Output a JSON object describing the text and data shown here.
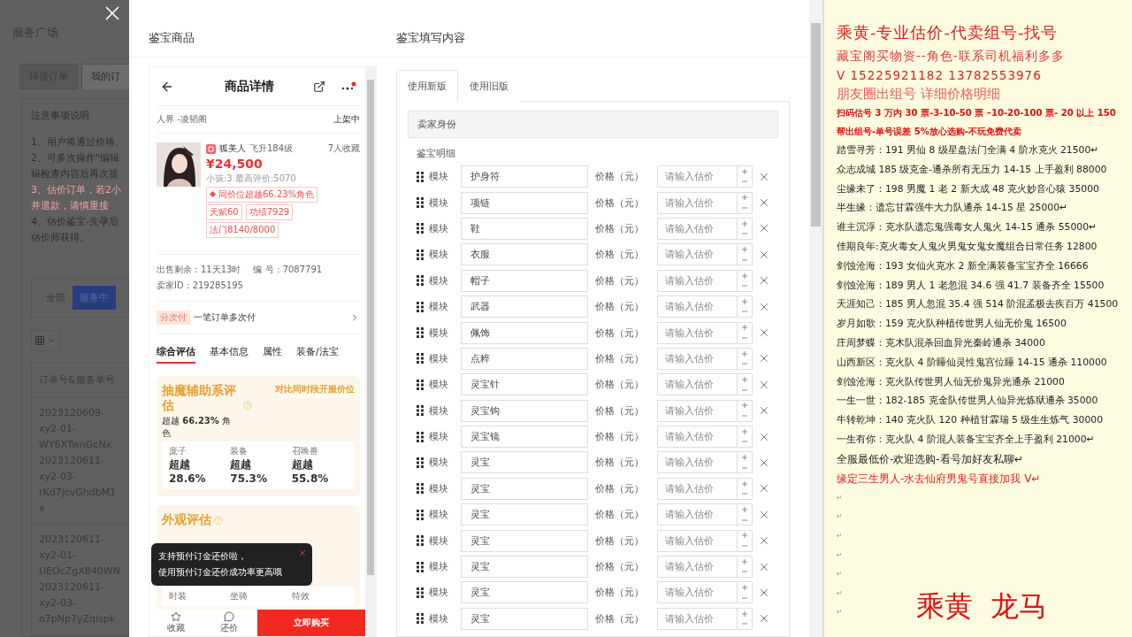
{
  "background_page": {
    "title": "服务广场",
    "tabs": [
      {
        "label": "待接订单",
        "selected": false
      },
      {
        "label": "我的订",
        "selected": true
      }
    ],
    "notice_title": "注意事项说明",
    "notice_lines": [
      {
        "text": "1、用户将通过价格、",
        "kind": "normal"
      },
      {
        "text": "2、可多次操作\"编辑",
        "kind": "normal"
      },
      {
        "text": "辑检查内容后再次提",
        "kind": "normal"
      },
      {
        "text": "3、估价订单，若2小",
        "kind": "warning"
      },
      {
        "text": "并退款，请慎重接",
        "kind": "warning"
      },
      {
        "text": "4、估价鉴宝-先孕后",
        "kind": "normal"
      },
      {
        "text": "估价师获得。",
        "kind": "normal"
      }
    ],
    "filters": [
      {
        "label": "全部",
        "selected": false
      },
      {
        "label": "服务中",
        "selected": true
      }
    ],
    "table": {
      "columns": [
        "订单号&服务单号"
      ],
      "rows": [
        [
          "2023120609-xy2-01-WY6XTwnGcNx",
          "2023120611-xy2-03-rKd7jcvGhdbM1x"
        ],
        [
          "2023120611-xy2-01-UEOcZgX840WN",
          "2023120611-xy2-03-o7pNp7yZqispk"
        ]
      ]
    }
  },
  "modal": {
    "left_title": "鉴宝商品",
    "right_title": "鉴宝填写内容"
  },
  "product": {
    "header_title": "商品详情",
    "server": "人界 -凌韬阁",
    "status": "上架中",
    "seller_name": "狐美人",
    "level": "飞升184级",
    "favorites": "7人收藏",
    "price": "¥24,500",
    "stats_line": "小孩:3 最高评价:5070",
    "rank_badge": "同价位超越66.23%角色",
    "tags": [
      "天赋60",
      "功绩7929",
      "法门8140/8000"
    ],
    "remaining": "出售剩余：11天13时",
    "serial": "编 号：7087791",
    "seller_id": "卖家ID：219285195",
    "installment_badge": "分次付",
    "installment_text": "一笔订单多次付",
    "tabs": [
      {
        "label": "综合评估",
        "selected": true
      },
      {
        "label": "基本信息",
        "selected": false
      },
      {
        "label": "属性",
        "selected": false
      },
      {
        "label": "装备/法宝",
        "selected": false
      }
    ],
    "evaluation": {
      "title": "抽魔辅助系评估",
      "compare_link": "对比同时段开服价位",
      "summary": "超越 **66.23%** 角色",
      "metrics": [
        {
          "label": "庞子",
          "value": "超越28.6%"
        },
        {
          "label": "装备",
          "value": "超越75.3%"
        },
        {
          "label": "召唤兽",
          "value": "超越55.8%"
        }
      ]
    },
    "appearance": {
      "title": "外观评估",
      "items": [
        "时装",
        "坐骑",
        "特效"
      ]
    },
    "toast": {
      "lines": [
        "支持预付订金还价啦，",
        "使用预付订金还价成功率更高哦"
      ]
    },
    "bottom_actions": [
      {
        "label": "收藏",
        "kind": "star"
      },
      {
        "label": "还价",
        "kind": "bargain"
      }
    ],
    "buy_button": "立即购买"
  },
  "form": {
    "tabs": [
      {
        "label": "使用新版",
        "selected": true
      },
      {
        "label": "使用旧版",
        "selected": false
      }
    ],
    "section_title": "卖家身份",
    "detail_title": "鉴宝明细",
    "rows": [
      {
        "label": "模块",
        "name": "护身符",
        "price_label": "价格（元）",
        "placeholder": "请输入估价"
      },
      {
        "label": "模块",
        "name": "项链",
        "price_label": "价格（元）",
        "placeholder": "请输入估价"
      },
      {
        "label": "模块",
        "name": "鞋",
        "price_label": "价格（元）",
        "placeholder": "请输入估价"
      },
      {
        "label": "模块",
        "name": "衣服",
        "price_label": "价格（元）",
        "placeholder": "请输入估价"
      },
      {
        "label": "模块",
        "name": "帽子",
        "price_label": "价格（元）",
        "placeholder": "请输入估价"
      },
      {
        "label": "模块",
        "name": "武器",
        "price_label": "价格（元）",
        "placeholder": "请输入估价"
      },
      {
        "label": "模块",
        "name": "佩饰",
        "price_label": "价格（元）",
        "placeholder": "请输入估价"
      },
      {
        "label": "模块",
        "name": "点粹",
        "price_label": "价格（元）",
        "placeholder": "请输入估价"
      },
      {
        "label": "模块",
        "name": "灵宝针",
        "price_label": "价格（元）",
        "placeholder": "请输入估价"
      },
      {
        "label": "模块",
        "name": "灵宝钩",
        "price_label": "价格（元）",
        "placeholder": "请输入估价"
      },
      {
        "label": "模块",
        "name": "灵宝镜",
        "price_label": "价格（元）",
        "placeholder": "请输入估价"
      },
      {
        "label": "模块",
        "name": "灵宝",
        "price_label": "价格（元）",
        "placeholder": "请输入估价"
      },
      {
        "label": "模块",
        "name": "灵宝",
        "price_label": "价格（元）",
        "placeholder": "请输入估价"
      },
      {
        "label": "模块",
        "name": "灵宝",
        "price_label": "价格（元）",
        "placeholder": "请输入估价"
      },
      {
        "label": "模块",
        "name": "灵宝",
        "price_label": "价格（元）",
        "placeholder": "请输入估价"
      },
      {
        "label": "模块",
        "name": "灵宝",
        "price_label": "价格（元）",
        "placeholder": "请输入估价"
      },
      {
        "label": "模块",
        "name": "灵宝",
        "price_label": "价格（元）",
        "placeholder": "请输入估价"
      },
      {
        "label": "模块",
        "name": "灵宝",
        "price_label": "价格（元）",
        "placeholder": "请输入估价"
      }
    ]
  },
  "ad_panel": {
    "lines": [
      {
        "text": "乘黄-专业估价-代卖组号-找号",
        "kind": "title",
        "color": "#e02020"
      },
      {
        "text": "藏宝阁买物资--角色-联系司机福利多多",
        "kind": "large",
        "color": "#e03a3a"
      },
      {
        "text": "V 15225921182    13782553976",
        "kind": "large",
        "color": "#e02020"
      },
      {
        "text": "朋友圈出组号     详细价格明细",
        "kind": "serif",
        "color": "#f05a5a"
      },
      {
        "text": "扫码估号 3 万内 30 票-3-10-50 票  –10-20-100 票- 20 以上 150",
        "kind": "bold",
        "color": "#e01010"
      },
      {
        "text": "帮出组号-单号误差 5%放心选购-不玩免费代卖",
        "kind": "bold",
        "color": "#e01010"
      },
      {
        "text": "踏雪寻芳：191 男仙 8 级星盘法门全满 4 阶水克火 21500↵",
        "kind": "normal",
        "color": "#222222"
      },
      {
        "text": "众志成城  185 级克金-通杀所有无压力 14-15 上手盈利 88000",
        "kind": "normal",
        "color": "#222222"
      },
      {
        "text": "尘缘未了：198 男魔 1 老 2 新大成 48 克火妙音心猿 35000",
        "kind": "normal",
        "color": "#222222"
      },
      {
        "text": "半生缘：遗忘甘霖强牛大力队通杀 14-15 星 25000↵",
        "kind": "normal",
        "color": "#222222"
      },
      {
        "text": "谁主沉浮：克水队遗忘鬼强毒女人鬼火 14-15 通杀 55000↵",
        "kind": "normal",
        "color": "#222222"
      },
      {
        "text": "佳期良年:克火毒女人鬼火男鬼女鬼女魔组合日常任务 12800",
        "kind": "normal",
        "color": "#222222"
      },
      {
        "text": "剑蚀沧海：193 女仙火克水 2 新全满装备宝宝齐全 16666",
        "kind": "normal",
        "color": "#222222"
      },
      {
        "text": "剑蚀沧海：189 男人 1 老忽混 34.6 强 41.7 装备齐全 15500",
        "kind": "normal",
        "color": "#222222"
      },
      {
        "text": "天涯知己：185 男人忽混 35.4 强 514 阶混孟极去疾百万 41500",
        "kind": "normal",
        "color": "#222222"
      },
      {
        "text": "岁月如歌：159 克火队种植传世男人仙无价鬼 16500",
        "kind": "normal",
        "color": "#222222"
      },
      {
        "text": "庄周梦蝶：克木队混杀回血异光秦岭通杀 34000",
        "kind": "normal",
        "color": "#222222"
      },
      {
        "text": "山西新区：克火队 4 阶睡仙灵性鬼宫位睡 14-15 通杀 110000",
        "kind": "normal",
        "color": "#222222"
      },
      {
        "text": "剑蚀沧海：克火队传世男人仙无价鬼异光通杀 21000",
        "kind": "normal",
        "color": "#222222"
      },
      {
        "text": "一生一世：182-185 克金队传世男人仙异光炼狱通杀 35000",
        "kind": "normal",
        "color": "#222222"
      },
      {
        "text": "牛转乾坤：140 克火队 120 种植甘霖瑞 5 级生生炼气 30000",
        "kind": "normal",
        "color": "#222222"
      },
      {
        "text": "一生有你：克火队 4 阶混人装备宝宝齐全上手盈利 21000↵",
        "kind": "normal",
        "color": "#222222"
      },
      {
        "text": "全服最低价-欢迎选购-看号加好友私聊↵",
        "kind": "medium",
        "color": "#222222"
      },
      {
        "text": "缘定三生男人-水去仙府男鬼号直接加我 V↵",
        "kind": "medium",
        "color": "#e02020"
      }
    ],
    "empty_marks": [
      "↵",
      "↵",
      "↵",
      "↵",
      "↵",
      "↵",
      "↵"
    ],
    "signature": "乘黄  龙马"
  }
}
